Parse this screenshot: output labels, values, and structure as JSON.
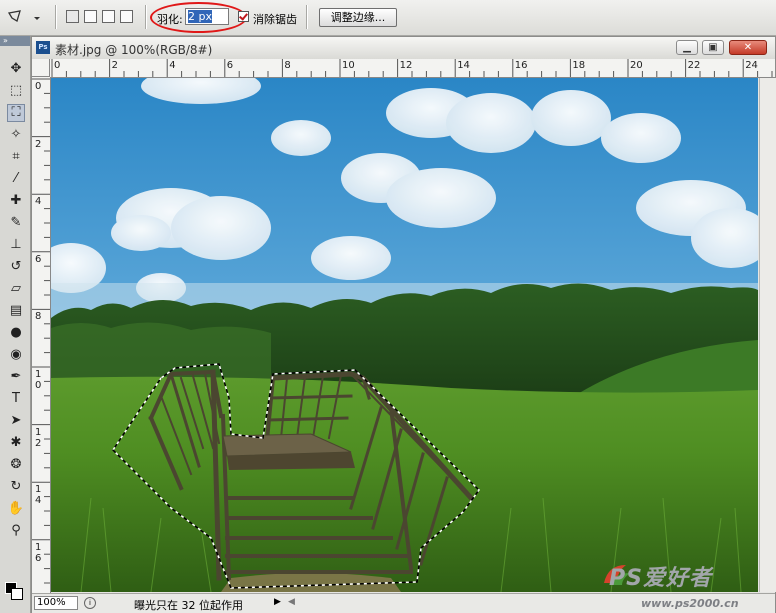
{
  "options_bar": {
    "feather_label": "羽化:",
    "feather_value": "2 px",
    "antialias_label": "消除锯齿",
    "antialias_checked": true,
    "refine_edge_label": "调整边缘...",
    "tool_icon": "polygonal-lasso-icon"
  },
  "toolbox": {
    "tools": [
      {
        "name": "move-tool-icon",
        "glyph": "✥"
      },
      {
        "name": "marquee-tool-icon",
        "glyph": "⬚"
      },
      {
        "name": "polygonal-lasso-tool-icon",
        "glyph": "⛶",
        "active": true
      },
      {
        "name": "magic-wand-tool-icon",
        "glyph": "✧"
      },
      {
        "name": "crop-tool-icon",
        "glyph": "⌗"
      },
      {
        "name": "eyedropper-tool-icon",
        "glyph": "⁄"
      },
      {
        "name": "healing-brush-tool-icon",
        "glyph": "✚"
      },
      {
        "name": "brush-tool-icon",
        "glyph": "✎"
      },
      {
        "name": "clone-stamp-tool-icon",
        "glyph": "⊥"
      },
      {
        "name": "history-brush-tool-icon",
        "glyph": "↺"
      },
      {
        "name": "eraser-tool-icon",
        "glyph": "▱"
      },
      {
        "name": "gradient-tool-icon",
        "glyph": "▤"
      },
      {
        "name": "blur-tool-icon",
        "glyph": "●"
      },
      {
        "name": "dodge-tool-icon",
        "glyph": "◉"
      },
      {
        "name": "pen-tool-icon",
        "glyph": "✒"
      },
      {
        "name": "type-tool-icon",
        "glyph": "T"
      },
      {
        "name": "path-selection-tool-icon",
        "glyph": "➤"
      },
      {
        "name": "shape-tool-icon",
        "glyph": "✱"
      },
      {
        "name": "3d-rotate-tool-icon",
        "glyph": "❂"
      },
      {
        "name": "3d-orbit-tool-icon",
        "glyph": "↻"
      },
      {
        "name": "hand-tool-icon",
        "glyph": "✋"
      },
      {
        "name": "zoom-tool-icon",
        "glyph": "⚲"
      }
    ]
  },
  "document": {
    "title": "素材.jpg @ 100%(RGB/8#)",
    "ps_badge": "Ps",
    "ruler_h_labels": [
      "0",
      "2",
      "4",
      "6",
      "8",
      "10",
      "12",
      "14",
      "16",
      "18",
      "20",
      "22",
      "24"
    ],
    "ruler_v_labels": [
      "0",
      "2",
      "4",
      "6",
      "8",
      "10",
      "12",
      "14",
      "16"
    ]
  },
  "status_bar": {
    "zoom": "100%",
    "message": "曝光只在 32 位起作用"
  },
  "watermark": {
    "brand": "PS爱好者",
    "url": "www.ps2000.cn"
  },
  "colors": {
    "annotation_circle": "#e01818",
    "selection_highlight": "#3166b8"
  }
}
